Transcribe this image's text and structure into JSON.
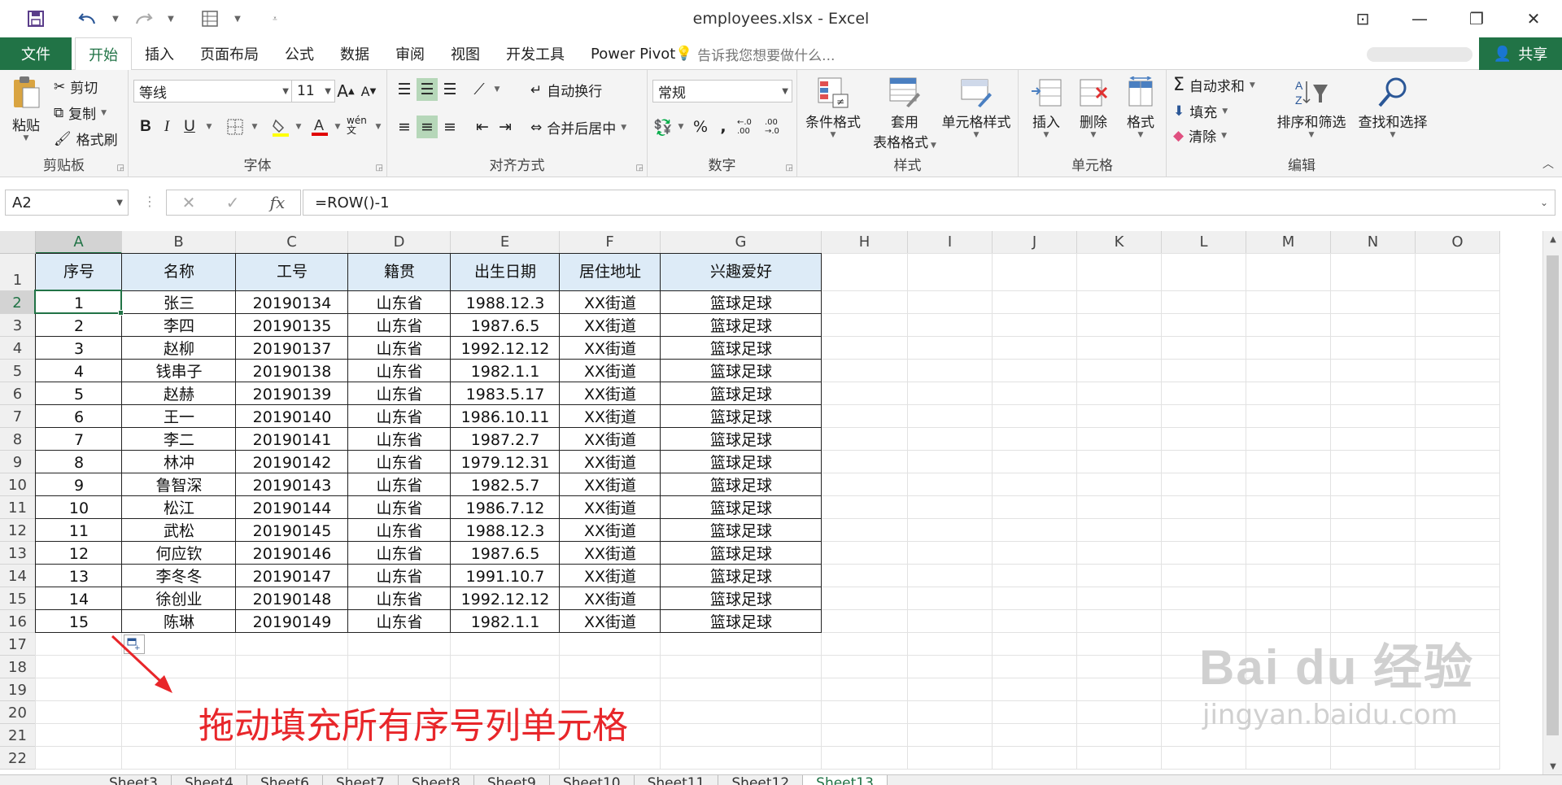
{
  "window": {
    "title": "employees.xlsx - Excel",
    "controls": [
      "⊡",
      "—",
      "❐",
      "✕"
    ]
  },
  "qat": {
    "save_icon": "save-icon",
    "undo_icon": "undo-icon",
    "redo_icon": "redo-icon",
    "form_icon": "form-icon"
  },
  "tabs": {
    "file": "文件",
    "items": [
      "开始",
      "插入",
      "页面布局",
      "公式",
      "数据",
      "审阅",
      "视图",
      "开发工具",
      "Power Pivot"
    ],
    "active": "开始",
    "tellme": "告诉我您想要做什么...",
    "share": "共享"
  },
  "ribbon": {
    "clipboard": {
      "label": "剪贴板",
      "paste": "粘贴",
      "cut": "剪切",
      "copy": "复制",
      "painter": "格式刷"
    },
    "font": {
      "label": "字体",
      "name": "等线",
      "size": "11",
      "bold": "B",
      "italic": "I",
      "underline": "U",
      "grow": "A",
      "shrink": "A",
      "phonetic": "wén 文"
    },
    "alignment": {
      "label": "对齐方式",
      "wrap": "自动换行",
      "merge": "合并后居中"
    },
    "number": {
      "label": "数字",
      "format": "常规",
      "percent": "%",
      "comma": ",",
      "inc_decimal": "←.0 .00",
      "dec_decimal": ".00 →.0"
    },
    "styles": {
      "label": "样式",
      "conditional": "条件格式",
      "table_line1": "套用",
      "table_line2": "表格格式",
      "cell_styles": "单元格样式"
    },
    "cells": {
      "label": "单元格",
      "insert": "插入",
      "delete": "删除",
      "format": "格式"
    },
    "editing": {
      "label": "编辑",
      "autosum": "自动求和",
      "fill": "填充",
      "clear": "清除",
      "sort": "排序和筛选",
      "find": "查找和选择"
    }
  },
  "formula_bar": {
    "name_box": "A2",
    "formula": "=ROW()-1",
    "fx": "fx",
    "cancel": "✕",
    "enter": "✓"
  },
  "grid": {
    "columns": [
      "A",
      "B",
      "C",
      "D",
      "E",
      "F",
      "G",
      "H",
      "I",
      "J",
      "K",
      "L",
      "M",
      "N",
      "O"
    ],
    "rows": [
      "1",
      "2",
      "3",
      "4",
      "5",
      "6",
      "7",
      "8",
      "9",
      "10",
      "11",
      "12",
      "13",
      "14",
      "15",
      "16",
      "17",
      "18",
      "19",
      "20",
      "21",
      "22"
    ],
    "selected_column": "A",
    "selected_row": "2",
    "table_header": [
      "序号",
      "名称",
      "工号",
      "籍贯",
      "出生日期",
      "居住地址",
      "兴趣爱好"
    ],
    "table_rows": [
      [
        "1",
        "张三",
        "20190134",
        "山东省",
        "1988.12.3",
        "XX街道",
        "篮球足球"
      ],
      [
        "2",
        "李四",
        "20190135",
        "山东省",
        "1987.6.5",
        "XX街道",
        "篮球足球"
      ],
      [
        "3",
        "赵柳",
        "20190137",
        "山东省",
        "1992.12.12",
        "XX街道",
        "篮球足球"
      ],
      [
        "4",
        "钱串子",
        "20190138",
        "山东省",
        "1982.1.1",
        "XX街道",
        "篮球足球"
      ],
      [
        "5",
        "赵赫",
        "20190139",
        "山东省",
        "1983.5.17",
        "XX街道",
        "篮球足球"
      ],
      [
        "6",
        "王一",
        "20190140",
        "山东省",
        "1986.10.11",
        "XX街道",
        "篮球足球"
      ],
      [
        "7",
        "李二",
        "20190141",
        "山东省",
        "1987.2.7",
        "XX街道",
        "篮球足球"
      ],
      [
        "8",
        "林冲",
        "20190142",
        "山东省",
        "1979.12.31",
        "XX街道",
        "篮球足球"
      ],
      [
        "9",
        "鲁智深",
        "20190143",
        "山东省",
        "1982.5.7",
        "XX街道",
        "篮球足球"
      ],
      [
        "10",
        "松江",
        "20190144",
        "山东省",
        "1986.7.12",
        "XX街道",
        "篮球足球"
      ],
      [
        "11",
        "武松",
        "20190145",
        "山东省",
        "1988.12.3",
        "XX街道",
        "篮球足球"
      ],
      [
        "12",
        "何应钦",
        "20190146",
        "山东省",
        "1987.6.5",
        "XX街道",
        "篮球足球"
      ],
      [
        "13",
        "李冬冬",
        "20190147",
        "山东省",
        "1991.10.7",
        "XX街道",
        "篮球足球"
      ],
      [
        "14",
        "徐创业",
        "20190148",
        "山东省",
        "1992.12.12",
        "XX街道",
        "篮球足球"
      ],
      [
        "15",
        "陈琳",
        "20190149",
        "山东省",
        "1982.1.1",
        "XX街道",
        "篮球足球"
      ]
    ]
  },
  "annotation": "拖动填充所有序号列单元格",
  "watermark": {
    "brand": "Bai du 经验",
    "url": "jingyan.baidu.com"
  },
  "sheet_tabs": [
    "Sheet3",
    "Sheet4",
    "Sheet6",
    "Sheet7",
    "Sheet8",
    "Sheet9",
    "Sheet10",
    "Sheet11",
    "Sheet12",
    "Sheet13"
  ],
  "active_sheet": "Sheet13",
  "colors": {
    "accent": "#217346",
    "header_fill": "#ddebf7",
    "annotation": "#e8262a"
  }
}
